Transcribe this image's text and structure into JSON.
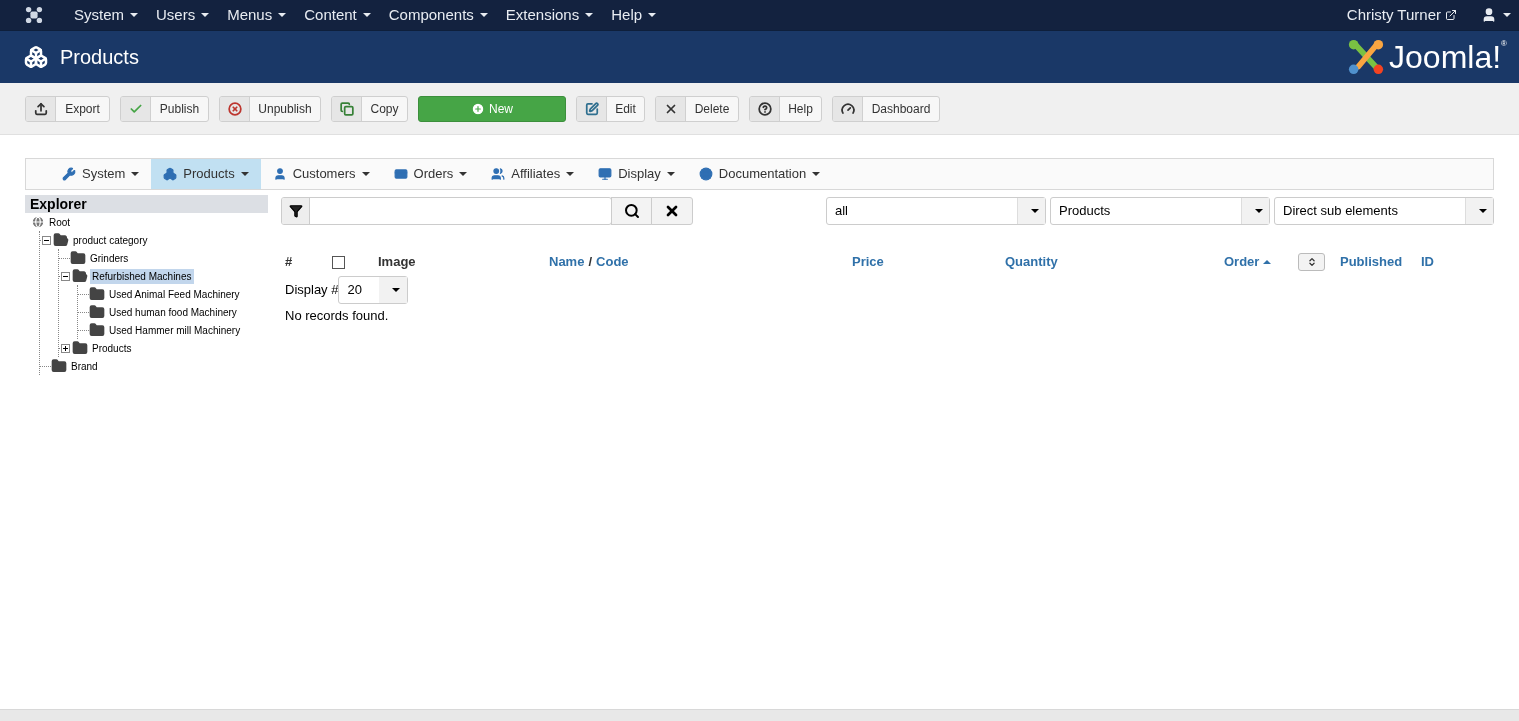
{
  "top_menu": [
    {
      "label": "System"
    },
    {
      "label": "Users"
    },
    {
      "label": "Menus"
    },
    {
      "label": "Content"
    },
    {
      "label": "Components"
    },
    {
      "label": "Extensions"
    },
    {
      "label": "Help"
    }
  ],
  "user": {
    "name": "Christy Turner"
  },
  "header": {
    "title": "Products",
    "logo_text": "Joomla!",
    "logo_mark": "®"
  },
  "toolbar": [
    {
      "label": "Export",
      "kind": "default"
    },
    {
      "label": "Publish",
      "kind": "default"
    },
    {
      "label": "Unpublish",
      "kind": "default"
    },
    {
      "label": "Copy",
      "kind": "default"
    },
    {
      "label": "New",
      "kind": "success"
    },
    {
      "label": "Edit",
      "kind": "default"
    },
    {
      "label": "Delete",
      "kind": "default"
    },
    {
      "label": "Help",
      "kind": "default"
    },
    {
      "label": "Dashboard",
      "kind": "default"
    }
  ],
  "sub_menu": [
    {
      "label": "System",
      "selected": false
    },
    {
      "label": "Products",
      "selected": true
    },
    {
      "label": "Customers",
      "selected": false
    },
    {
      "label": "Orders",
      "selected": false
    },
    {
      "label": "Affiliates",
      "selected": false
    },
    {
      "label": "Display",
      "selected": false
    },
    {
      "label": "Documentation",
      "selected": false
    }
  ],
  "explorer": {
    "title": "Explorer",
    "root": "Root",
    "tree": [
      {
        "label": "product category",
        "expanded": true,
        "selected": false,
        "children": [
          {
            "label": "Grinders",
            "selected": false
          },
          {
            "label": "Refurbished Machines",
            "expanded": true,
            "selected": true,
            "children": [
              {
                "label": "Used Animal Feed Machinery",
                "selected": false
              },
              {
                "label": "Used human food Machinery",
                "selected": false
              },
              {
                "label": "Used Hammer mill Machinery",
                "selected": false
              }
            ]
          },
          {
            "label": "Products",
            "expanded": false,
            "selected": false
          }
        ]
      },
      {
        "label": "Brand",
        "selected": false
      }
    ]
  },
  "filters": {
    "selects": [
      {
        "value": "all"
      },
      {
        "value": "Products"
      },
      {
        "value": "Direct sub elements"
      }
    ]
  },
  "table": {
    "columns": [
      {
        "kind": "text",
        "label": "#"
      },
      {
        "kind": "checkbox",
        "checked": false
      },
      {
        "kind": "text",
        "label": "Image"
      },
      {
        "kind": "pair",
        "parts": [
          "Name",
          "Code"
        ],
        "separator": "/"
      },
      {
        "kind": "link",
        "label": "Price"
      },
      {
        "kind": "link",
        "label": "Quantity"
      },
      {
        "kind": "sorted",
        "label": "Order"
      },
      {
        "kind": "sort_button"
      },
      {
        "kind": "link",
        "label": "Published"
      },
      {
        "kind": "link",
        "label": "ID"
      }
    ],
    "display_label": "Display #",
    "display_value": "20",
    "empty_message": "No records found."
  }
}
